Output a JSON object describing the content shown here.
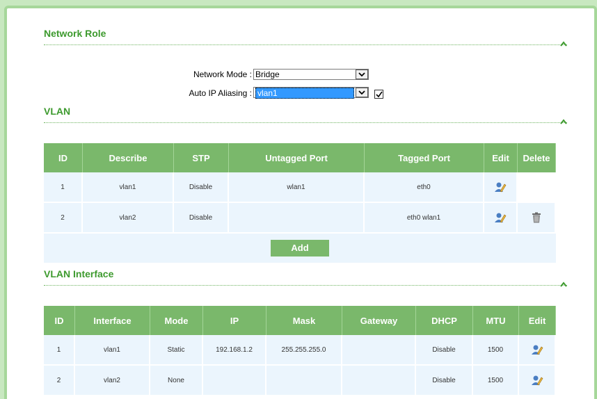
{
  "network_role": {
    "title": "Network Role",
    "network_mode_label": "Network Mode :",
    "network_mode_value": "Bridge",
    "auto_ip_label": "Auto IP Aliasing :",
    "auto_ip_value": "vlan1",
    "auto_ip_checked": true
  },
  "vlan": {
    "title": "VLAN",
    "columns": [
      "ID",
      "Describe",
      "STP",
      "Untagged Port",
      "Tagged Port",
      "Edit",
      "Delete"
    ],
    "rows": [
      {
        "id": "1",
        "describe": "vlan1",
        "stp": "Disable",
        "untagged": "wlan1",
        "tagged": "eth0"
      },
      {
        "id": "2",
        "describe": "vlan2",
        "stp": "Disable",
        "untagged": "",
        "tagged": "eth0 wlan1"
      }
    ],
    "add_label": "Add"
  },
  "vlan_interface": {
    "title": "VLAN Interface",
    "columns": [
      "ID",
      "Interface",
      "Mode",
      "IP",
      "Mask",
      "Gateway",
      "DHCP",
      "MTU",
      "Edit"
    ],
    "rows": [
      {
        "id": "1",
        "interface": "vlan1",
        "mode": "Static",
        "ip": "192.168.1.2",
        "mask": "255.255.255.0",
        "gateway": "",
        "dhcp": "Disable",
        "mtu": "1500"
      },
      {
        "id": "2",
        "interface": "vlan2",
        "mode": "None",
        "ip": "",
        "mask": "",
        "gateway": "",
        "dhcp": "Disable",
        "mtu": "1500"
      }
    ]
  },
  "icons": {
    "collapse": "chevron-up-icon",
    "edit": "edit-user-icon",
    "delete": "trash-icon",
    "dropdown": "chevron-down-icon",
    "check": "checkmark-icon"
  },
  "colors": {
    "accent_green": "#7ab86b",
    "title_green": "#3d9a2e",
    "row_bg": "#ebf5fd",
    "frame_green": "#a6d79a"
  }
}
